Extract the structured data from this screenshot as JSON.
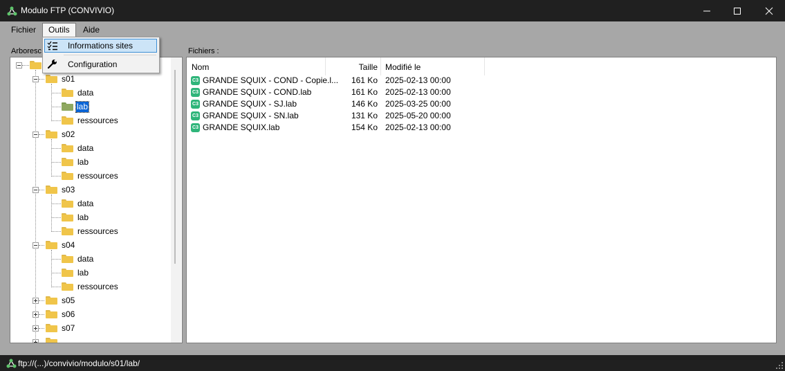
{
  "window": {
    "title": "Modulo FTP (CONVIVIO)",
    "minimize_glyph": "—",
    "maximize_glyph": "☐",
    "close_glyph": "✕"
  },
  "menu": {
    "fichier": "Fichier",
    "outils": "Outils",
    "aide": "Aide"
  },
  "dropdown": {
    "items": [
      {
        "label": "Informations sites",
        "icon": "checklist-icon",
        "highlighted": true
      },
      {
        "label": "Configuration",
        "icon": "wrench-icon",
        "highlighted": false
      }
    ]
  },
  "tree": {
    "group_label": "Arboresc",
    "nodes": {
      "s01": "s01",
      "s01_data": "data",
      "s01_lab": "lab",
      "s01_ressources": "ressources",
      "s02": "s02",
      "s02_data": "data",
      "s02_lab": "lab",
      "s02_ressources": "ressources",
      "s03": "s03",
      "s03_data": "data",
      "s03_lab": "lab",
      "s03_ressources": "ressources",
      "s04": "s04",
      "s04_data": "data",
      "s04_lab": "lab",
      "s04_ressources": "ressources",
      "s05": "s05",
      "s06": "s06",
      "s07": "s07"
    },
    "selected": "s01/lab"
  },
  "files": {
    "group_label": "Fichiers :",
    "columns": {
      "name": "Nom",
      "size": "Taille",
      "modified": "Modifié le"
    },
    "rows": [
      {
        "name": "GRANDE SQUIX - COND - Copie.l...",
        "size": "161 Ko",
        "modified": "2025-02-13 00:00"
      },
      {
        "name": "GRANDE SQUIX - COND.lab",
        "size": "161 Ko",
        "modified": "2025-02-13 00:00"
      },
      {
        "name": "GRANDE SQUIX - SJ.lab",
        "size": "146 Ko",
        "modified": "2025-03-25 00:00"
      },
      {
        "name": "GRANDE SQUIX - SN.lab",
        "size": "131 Ko",
        "modified": "2025-05-20 00:00"
      },
      {
        "name": "GRANDE SQUIX.lab",
        "size": "154 Ko",
        "modified": "2025-02-13 00:00"
      }
    ],
    "file_icon_glyph": "C3"
  },
  "status": {
    "path": "ftp://(...)/convivio/modulo/s01/lab/"
  },
  "colors": {
    "titlebar": "#202020",
    "selection": "#0a64d6",
    "menu_highlight": "#cce4f7",
    "folder": "#f0c54a",
    "file_icon": "#2fb57a"
  }
}
